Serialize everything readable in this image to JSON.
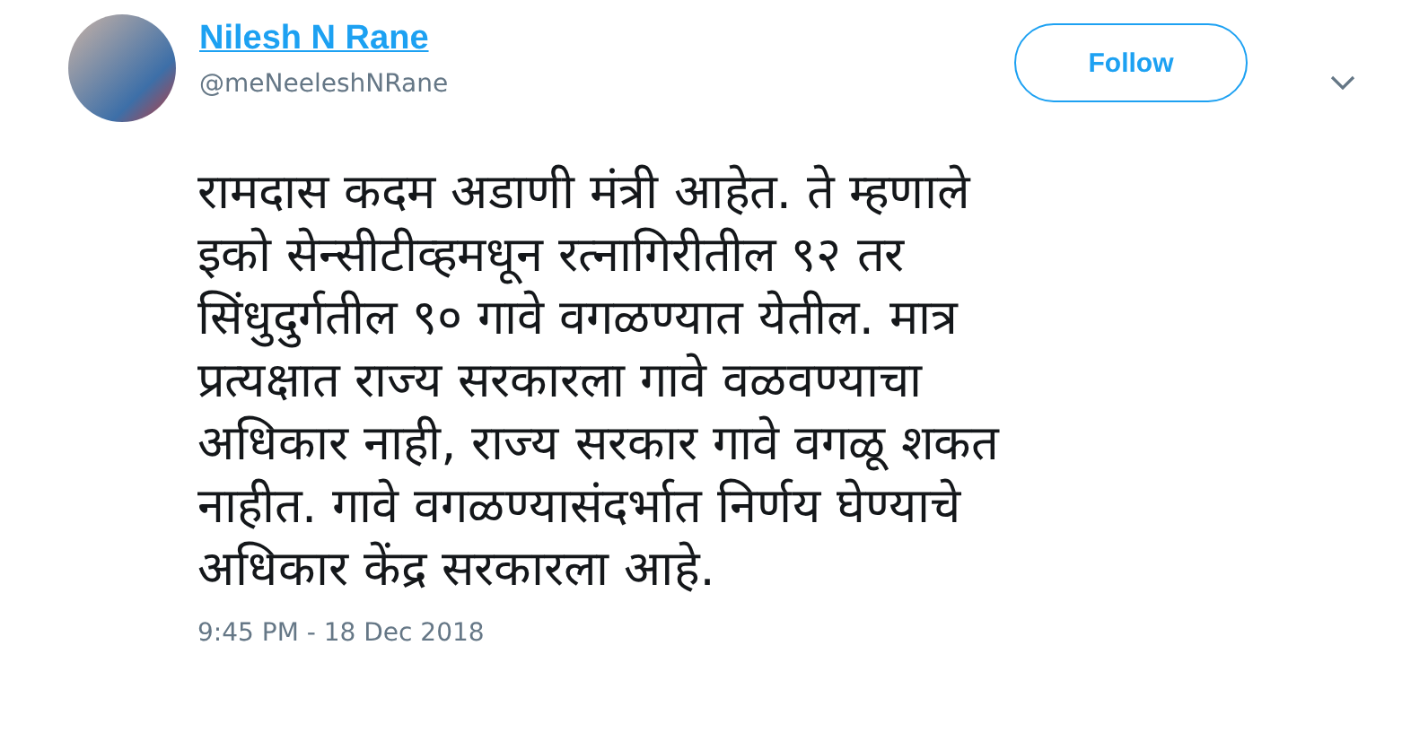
{
  "author": {
    "name": "Nilesh N Rane",
    "handle": "@meNeeleshNRane"
  },
  "follow_button": {
    "label": "Follow"
  },
  "tweet": {
    "text": "रामदास कदम अडाणी मंत्री आहेत. ते म्हणाले\nइको सेन्सीटीव्हमधून रत्नागिरीतील ९२ तर\nसिंधुदुर्गतील ९० गावे वगळण्यात येतील. मात्र\nप्रत्यक्षात राज्य सरकारला गावे वळवण्याचा\nअधिकार नाही, राज्य सरकार गावे वगळू शकत\nनाहीत. गावे वगळण्यासंदर्भात निर्णय घेण्याचे\nअधिकार केंद्र सरकारला आहे.",
    "timestamp": "9:45 PM - 18 Dec 2018"
  }
}
